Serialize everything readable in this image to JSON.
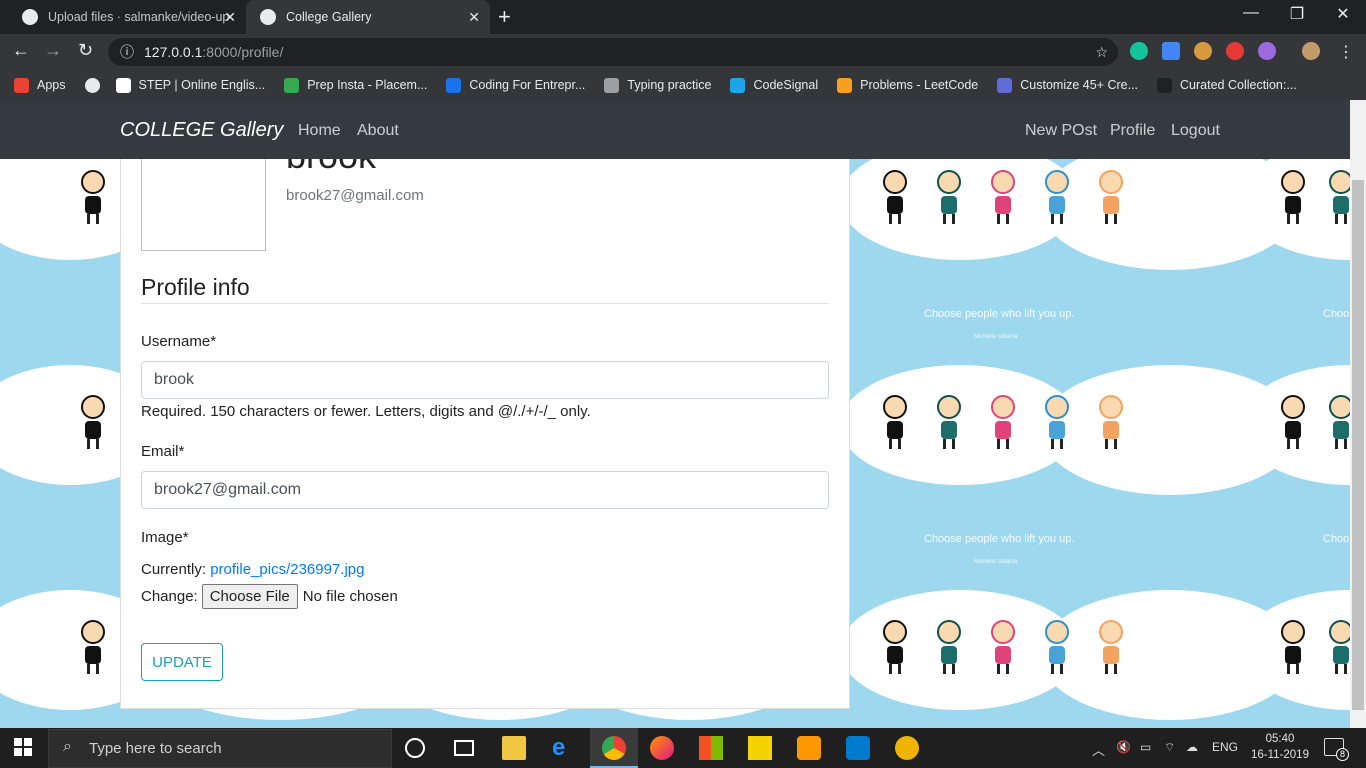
{
  "browser": {
    "tabs": [
      {
        "title": "Upload files · salmanke/video-up",
        "active": false
      },
      {
        "title": "College Gallery",
        "active": true
      }
    ],
    "url_host": "127.0.0.1",
    "url_rest": ":8000/profile/",
    "bookmarks": [
      {
        "label": "Apps",
        "color": "#ea4335"
      },
      {
        "label": "",
        "color": "#e8eaed"
      },
      {
        "label": "STEP | Online Englis...",
        "color": "#ffffff"
      },
      {
        "label": "Prep Insta - Placem...",
        "color": "#34a853"
      },
      {
        "label": "Coding For Entrepr...",
        "color": "#1a73e8"
      },
      {
        "label": "Typing practice",
        "color": "#9aa0a6"
      },
      {
        "label": "CodeSignal",
        "color": "#1ea5e8"
      },
      {
        "label": "Problems - LeetCode",
        "color": "#f89f1b"
      },
      {
        "label": "Customize 45+ Cre...",
        "color": "#5f6bd8"
      },
      {
        "label": "Curated Collection:...",
        "color": "#202124"
      }
    ]
  },
  "navbar": {
    "brand": "COLLEGE Gallery",
    "left_links": [
      "Home",
      "About"
    ],
    "right_links": [
      "New POst",
      "Profile",
      "Logout"
    ]
  },
  "profile": {
    "username": "brook",
    "email": "brook27@gmail.com"
  },
  "form": {
    "legend": "Profile info",
    "username_label": "Username*",
    "username_value": "brook",
    "username_help": "Required. 150 characters or fewer. Letters, digits and @/./+/-/_ only.",
    "email_label": "Email*",
    "email_value": "brook27@gmail.com",
    "image_label": "Image*",
    "currently_label": "Currently:",
    "currently_link": "profile_pics/236997.jpg",
    "change_label": "Change:",
    "choose_file": "Choose File",
    "no_file": "No file chosen",
    "submit": "UPDATE"
  },
  "wallpaper": {
    "quote": "Choose people who lift you up.",
    "author": "Michelle Obama",
    "quote_partial": "Choo"
  },
  "taskbar": {
    "search_placeholder": "Type here to search",
    "language": "ENG",
    "time": "05:40",
    "date": "16-11-2019",
    "notifications": "8"
  }
}
